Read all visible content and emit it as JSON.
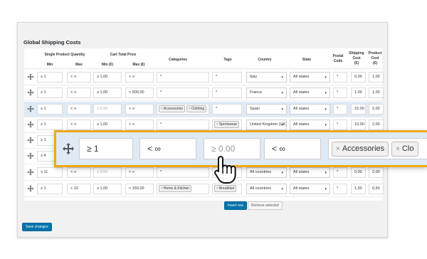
{
  "panel": {
    "title": "Global Shipping Costs"
  },
  "headers": {
    "single_product_quantity": "Single Product Quantity",
    "cart_total_price": "Cart Total Price",
    "min": "Min",
    "max": "Max",
    "min_eur": "Min (€)",
    "max_eur": "Max (€)",
    "categories": "Categories",
    "tags": "Tags",
    "country": "Country",
    "state": "State",
    "postal": "Postal",
    "postal2": "Code",
    "shipping": "Shipping",
    "shipping2": "Cost",
    "shipping3": "(€)",
    "product": "Product",
    "product2": "Cost",
    "product3": "(€)"
  },
  "rows": [
    {
      "qmin": "≥ 1",
      "qmax": "< ∞",
      "pmin": "≥ 1,00",
      "pmax": "< ∞",
      "cat": "*",
      "tag": "*",
      "country": "Italy",
      "state": "All states",
      "postal": "*",
      "ship": "0,00",
      "prod": "1,00"
    },
    {
      "qmin": "≥ 1",
      "qmax": "< ∞",
      "pmin": "≥ 1,00",
      "pmax": "< 500,00",
      "cat": "*",
      "tag": "*",
      "country": "France",
      "state": "All states",
      "postal": "*",
      "ship": "1,00",
      "prod": "1,00"
    },
    {
      "qmin": "≥ 1",
      "qmax": "< ∞",
      "pmin": "≥ 0.00",
      "pmax": "< ∞",
      "cat_tags": [
        "Accessories",
        "Clothing"
      ],
      "tag": "*",
      "country": "Spain",
      "state": "All states",
      "postal": "*",
      "ship": "15,00",
      "prod": "2,00"
    },
    {
      "qmin": "≥ 1",
      "qmax": "< ∞",
      "pmin": "≥ 1,00",
      "pmax": "< ∞",
      "cat": "*",
      "tag_tags": [
        "Sportswear"
      ],
      "country": "United Kingdom (UK)",
      "state": "All states",
      "postal": "*",
      "ship": "10,00",
      "prod": "2,00"
    },
    {
      "qmin": "≥ 1",
      "qmax": "",
      "pmin": "",
      "pmax": "",
      "cat": "",
      "tag": "",
      "country": "",
      "state": "",
      "postal": "",
      "ship": "",
      "prod": ""
    },
    {
      "qmin": "≥ 4",
      "qmax": "",
      "pmin": "",
      "pmax": "",
      "cat": "",
      "tag": "",
      "country": "",
      "state": "",
      "postal": "",
      "ship": "",
      "prod": ""
    },
    {
      "qmin": "≥ 11",
      "qmax": "< ∞",
      "pmin": "≥ 0.00",
      "pmax": "< ∞",
      "cat": "*",
      "tag": "*",
      "country": "All countries",
      "state": "All states",
      "postal": "*",
      "ship": "0,00",
      "prod": "2,00"
    },
    {
      "qmin": "≥ 1",
      "qmax": "< 10",
      "pmin": "≥ 1,00",
      "pmax": "< 150,00",
      "cat_tags": [
        "Home & Kitchen"
      ],
      "tag_tags": [
        "Breakfast"
      ],
      "country": "All countries",
      "state": "All states",
      "postal": "*",
      "ship": "1,50",
      "prod": "0,50"
    }
  ],
  "buttons": {
    "insert_row": "Insert row",
    "remove_selected": "Remove selected",
    "save_changes": "Save changes"
  },
  "zoom": {
    "qmin": "≥ 1",
    "qmax": "< ∞",
    "pmin": "≥ 0.00",
    "pmax": "< ∞",
    "tags": [
      "Accessories",
      "Clo"
    ]
  },
  "icons": {
    "drag": "move-arrows-icon",
    "cursor": "hand-pointer-icon",
    "remove": "remove-x-icon",
    "dropdown": "dropdown-arrow-icon"
  },
  "colors": {
    "primary": "#0073aa",
    "highlight_row": "#dfeaf5",
    "zoom_border": "#f0a81c"
  }
}
